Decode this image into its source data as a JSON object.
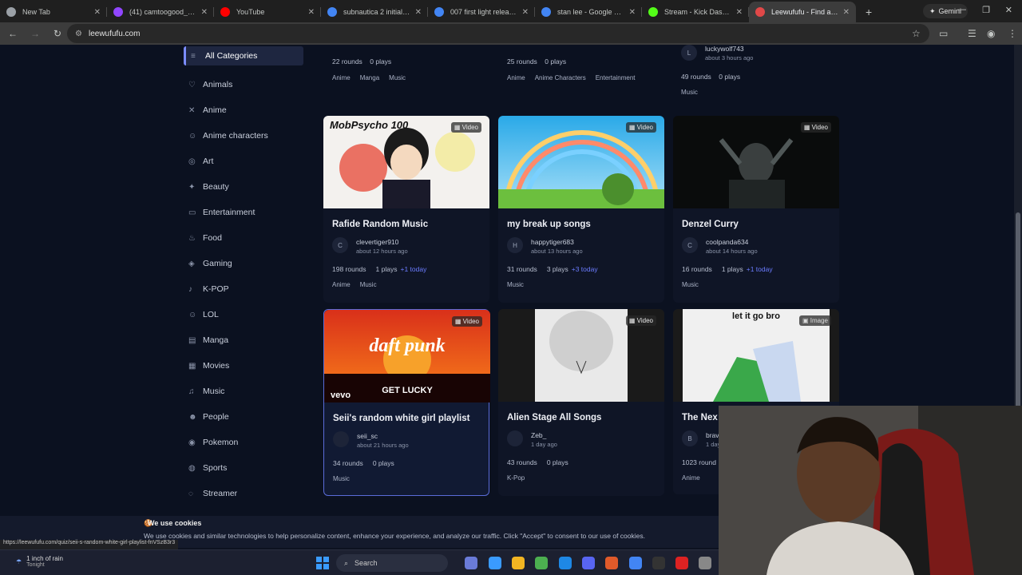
{
  "browser": {
    "tabs": [
      {
        "title": "New Tab",
        "color": "#9aa0a6"
      },
      {
        "title": "(41) camtoogood_ - Vid",
        "color": "#9146ff"
      },
      {
        "title": "YouTube",
        "color": "#ff0000"
      },
      {
        "title": "subnautica 2 initial relea",
        "color": "#4285f4"
      },
      {
        "title": "007 first light release da",
        "color": "#4285f4"
      },
      {
        "title": "stan lee - Google Search",
        "color": "#4285f4"
      },
      {
        "title": "Stream - Kick Dashboar",
        "color": "#53fc18"
      },
      {
        "title": "Leewufufu - Find and P",
        "color": "#e04848",
        "active": true
      }
    ],
    "gemini_label": "Gemini",
    "url": "leewufufu.com",
    "status_url": "https://leewufufu.com/quiz/seii-s-random-white-girl-playlist-fnVSzB3r3"
  },
  "sidebar": {
    "items": [
      {
        "label": "All Categories",
        "icon": "list-icon",
        "glyph": "≡",
        "active": true
      },
      {
        "label": "Animals",
        "icon": "paw-icon",
        "glyph": "♡"
      },
      {
        "label": "Anime",
        "icon": "swords-icon",
        "glyph": "✕"
      },
      {
        "label": "Anime characters",
        "icon": "person-icon",
        "glyph": "☺"
      },
      {
        "label": "Art",
        "icon": "palette-icon",
        "glyph": "◎"
      },
      {
        "label": "Beauty",
        "icon": "sparkle-icon",
        "glyph": "✦"
      },
      {
        "label": "Entertainment",
        "icon": "tv-icon",
        "glyph": "▭"
      },
      {
        "label": "Food",
        "icon": "food-icon",
        "glyph": "♨"
      },
      {
        "label": "Gaming",
        "icon": "gamepad-icon",
        "glyph": "◈"
      },
      {
        "label": "K-POP",
        "icon": "mic-icon",
        "glyph": "♪"
      },
      {
        "label": "LOL",
        "icon": "laugh-icon",
        "glyph": "☺"
      },
      {
        "label": "Manga",
        "icon": "book-icon",
        "glyph": "▤"
      },
      {
        "label": "Movies",
        "icon": "film-icon",
        "glyph": "▦"
      },
      {
        "label": "Music",
        "icon": "music-icon",
        "glyph": "♫"
      },
      {
        "label": "People",
        "icon": "person-icon",
        "glyph": "☻"
      },
      {
        "label": "Pokemon",
        "icon": "pokeball-icon",
        "glyph": "◉"
      },
      {
        "label": "Sports",
        "icon": "ball-icon",
        "glyph": "◍"
      },
      {
        "label": "Streamer",
        "icon": "broadcast-icon",
        "glyph": "◌"
      }
    ]
  },
  "top_partial_cards": [
    {
      "stats": "22 rounds    0 plays",
      "tags": [
        "Anime",
        "Manga",
        "Music"
      ]
    },
    {
      "stats": "25 rounds    0 plays",
      "tags": [
        "Anime",
        "Anime Characters",
        "Entertainment"
      ]
    },
    {
      "author": "luckywolf743",
      "ago": "about 3 hours ago",
      "initial": "L",
      "stats": "49 rounds    0 plays",
      "tags": [
        "Music"
      ]
    }
  ],
  "cards": [
    {
      "title": "Rafide Random Music",
      "badge": "Video",
      "initial": "C",
      "author": "clevertiger910",
      "ago": "about 12 hours ago",
      "rounds": "198 rounds",
      "plays": "1 plays",
      "today": "+1 today",
      "tags": [
        "Anime",
        "Music"
      ],
      "thumb_text": "MobPsycho 100"
    },
    {
      "title": "my break up songs",
      "badge": "Video",
      "initial": "H",
      "author": "happytiger683",
      "ago": "about 13 hours ago",
      "rounds": "31 rounds",
      "plays": "3 plays",
      "today": "+3 today",
      "tags": [
        "Music"
      ]
    },
    {
      "title": "Denzel Curry",
      "badge": "Video",
      "initial": "C",
      "author": "coolpanda634",
      "ago": "about 14 hours ago",
      "rounds": "16 rounds",
      "plays": "1 plays",
      "today": "+1 today",
      "tags": [
        "Music"
      ]
    },
    {
      "title": "Seii's random white girl playlist",
      "badge": "Video",
      "initial": "",
      "author": "seii_sc",
      "ago": "about 21 hours ago",
      "rounds": "34 rounds",
      "plays": "0 plays",
      "today": "",
      "tags": [
        "Music"
      ],
      "thumb_text": "daft punk",
      "thumb_sub": "GET LUCKY",
      "thumb_logo": "vevo"
    },
    {
      "title": "Alien Stage All Songs",
      "badge": "Video",
      "initial": "",
      "author": "Zeb_",
      "ago": "1 day ago",
      "rounds": "43 rounds",
      "plays": "0 plays",
      "today": "",
      "tags": [
        "K-Pop"
      ]
    },
    {
      "title": "The Nex",
      "badge": "Image",
      "initial": "B",
      "author": "brav",
      "ago": "1 day",
      "rounds": "1023 round",
      "plays": "",
      "today": "",
      "tags": [
        "Anime"
      ],
      "thumb_text": "let it go bro"
    }
  ],
  "cookie": {
    "title": "We use cookies",
    "text": "We use cookies and similar technologies to help personalize content, enhance your experience, and analyze our traffic. Click \"Accept\" to consent to our use of cookies."
  },
  "taskbar": {
    "weather_title": "1 inch of rain",
    "weather_sub": "Tonight",
    "search_label": "Search"
  }
}
